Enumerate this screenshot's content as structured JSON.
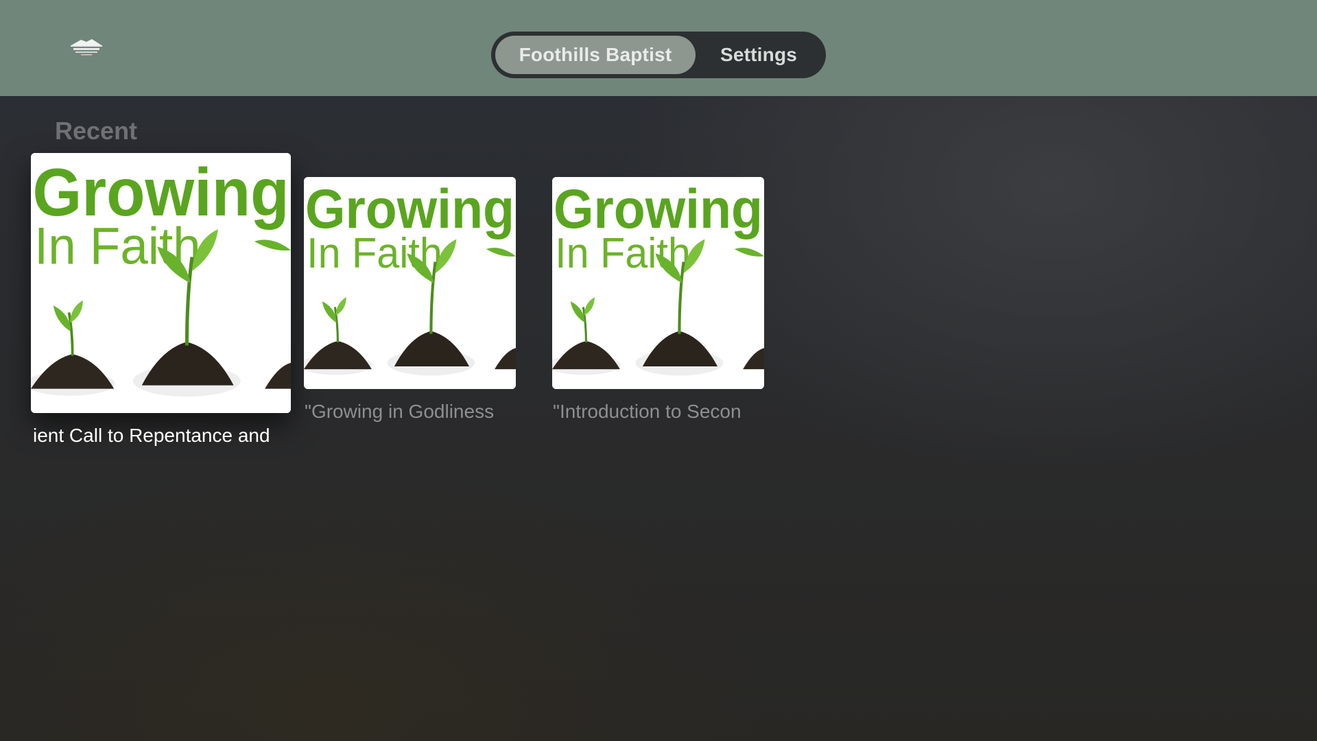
{
  "header": {
    "tabs": [
      {
        "label": "Foothills Baptist",
        "selected": true
      },
      {
        "label": "Settings",
        "selected": false
      }
    ]
  },
  "recent": {
    "title": "Recent",
    "items": [
      {
        "title": "ient Call to Repentance and",
        "art_line1": "Growing",
        "art_line2": "In Faith",
        "focused": true
      },
      {
        "title": "\"Growing in Godliness",
        "art_line1": "Growing",
        "art_line2": "In Faith",
        "focused": false
      },
      {
        "title": "\"Introduction to Secon",
        "art_line1": "Growing",
        "art_line2": "In Faith",
        "focused": false
      }
    ]
  },
  "colors": {
    "topbar": "#71867a",
    "tab_active_bg": "#8e9690",
    "tab_group_bg": "#2c3032",
    "art_green": "#5aa51f"
  }
}
